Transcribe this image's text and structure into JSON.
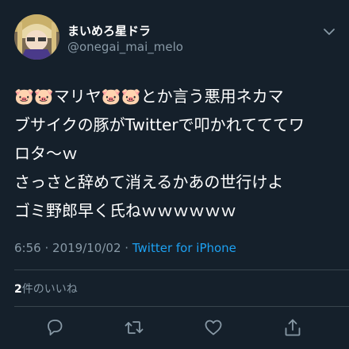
{
  "user": {
    "display_name": "まいめろ星ドラ",
    "handle": "@onegai_mai_melo"
  },
  "tweet": {
    "text": "🐷🐷マリヤ🐷🐷とか言う悪用ネカマ\nブサイクの豚がTwitterで叩かれてててワ\nロタ〜ｗ\nさっさと辞めて消えるかあの世行けよ\nゴミ野郎早く氏ねｗｗｗｗｗｗ"
  },
  "meta": {
    "time": "6:56",
    "date": "2019/10/02",
    "separator": "·",
    "source": "Twitter for iPhone"
  },
  "likes": {
    "count": "2",
    "label": "件のいいね"
  },
  "icons": {
    "caret": "chevron-down-icon",
    "reply": "reply-icon",
    "retweet": "retweet-icon",
    "like": "heart-icon",
    "share": "share-icon"
  },
  "colors": {
    "background": "#15202b",
    "secondary_text": "#8899a6",
    "link": "#1da1f2",
    "divider": "#38444d"
  }
}
